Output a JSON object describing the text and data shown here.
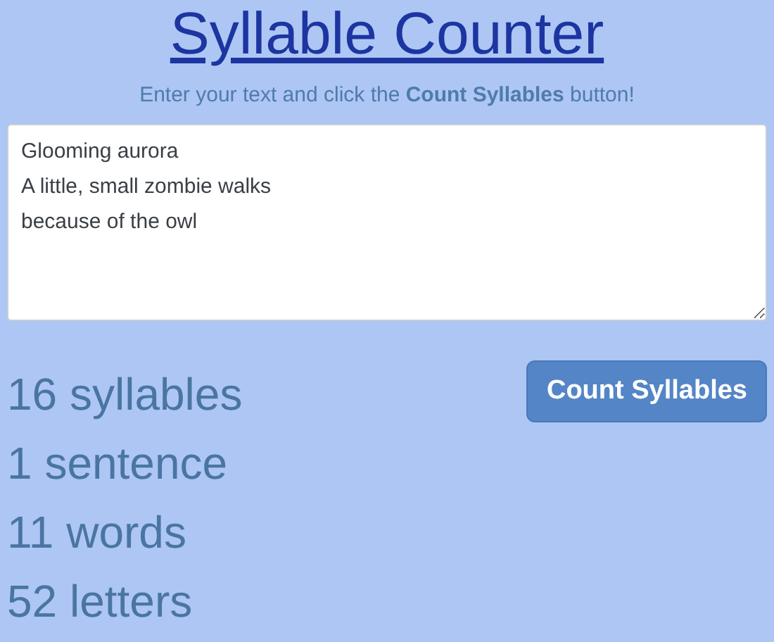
{
  "title": "Syllable Counter",
  "instructions": "Enter your text and click the **Count Syllables** button!",
  "text_input": {
    "value": "Glooming aurora\nA little, small zombie walks\nbecause of the owl"
  },
  "results": [
    "16 syllables",
    "1 sentence",
    "11 words",
    "52 letters"
  ],
  "button": "Count Syllables"
}
